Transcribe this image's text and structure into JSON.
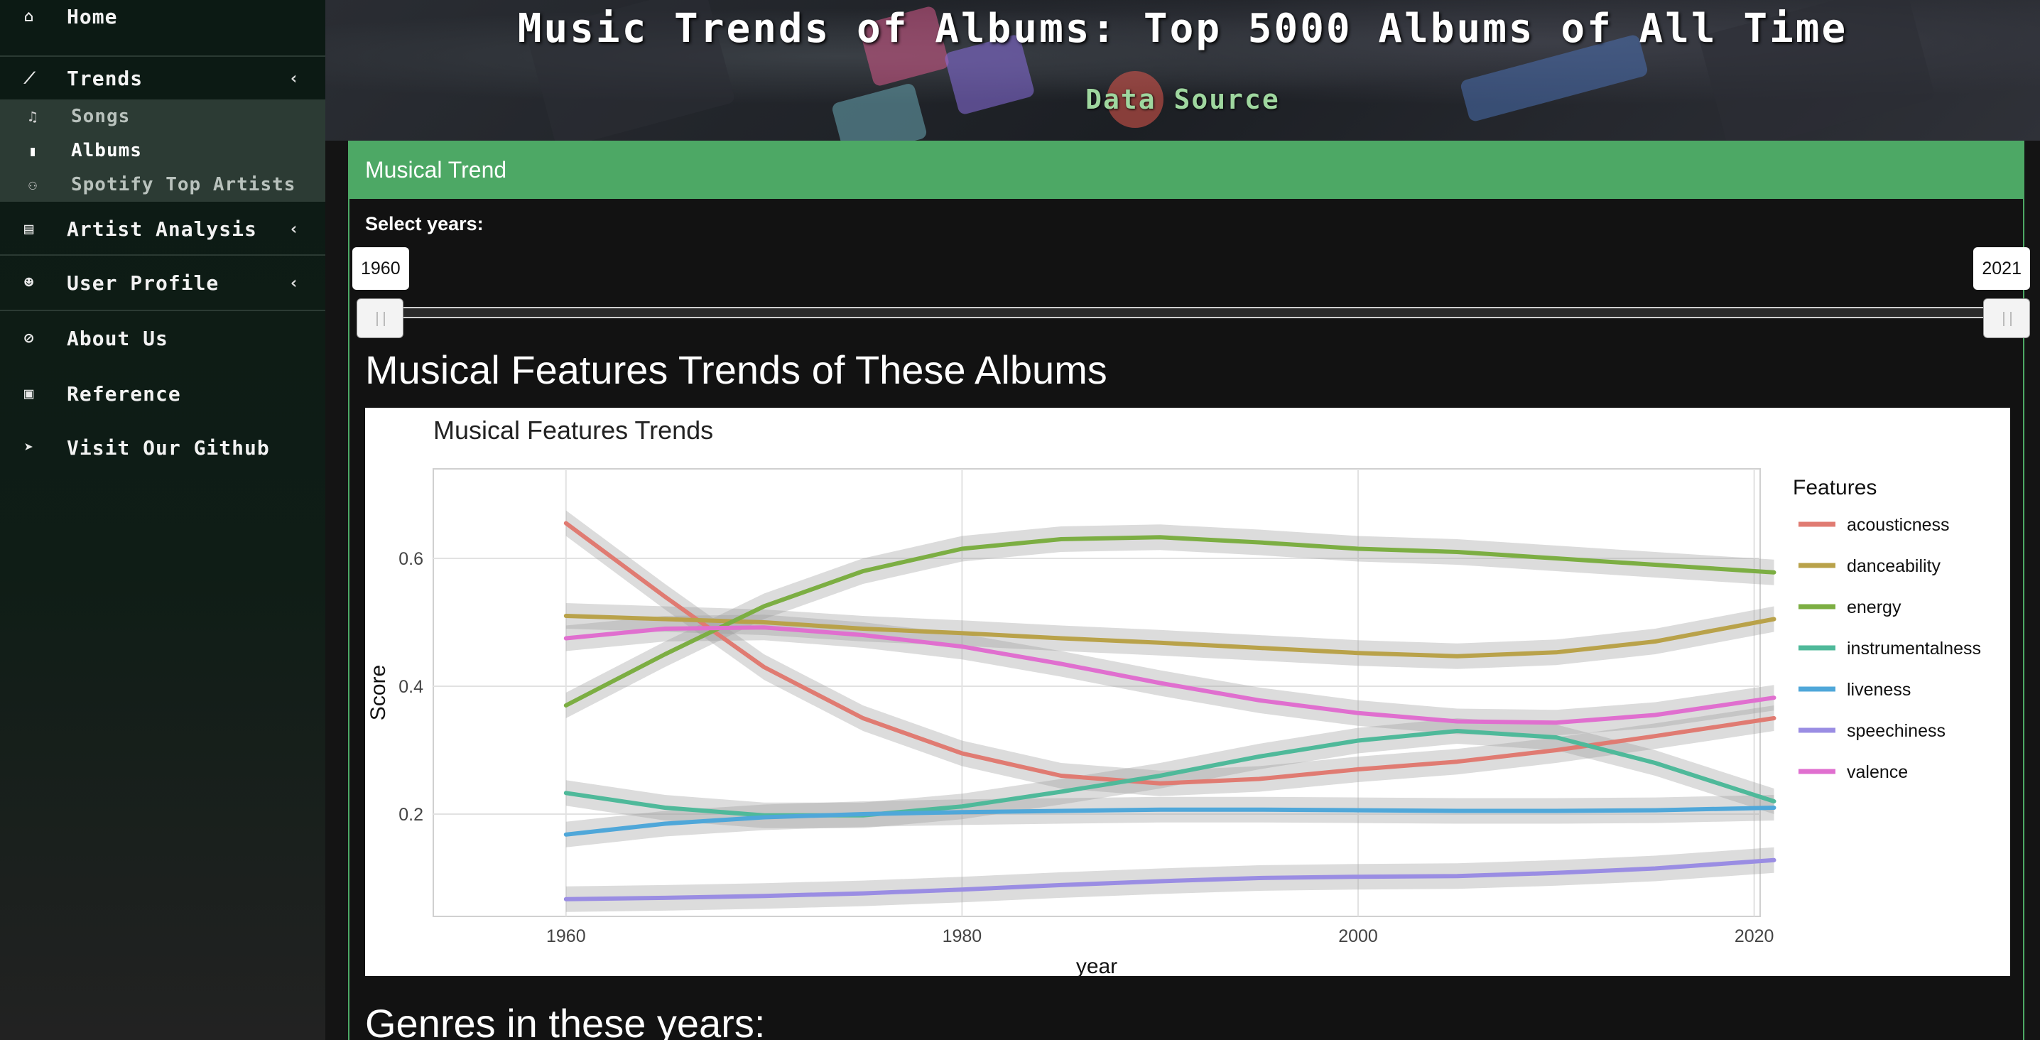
{
  "sidebar": {
    "items": [
      {
        "label": "Home",
        "icon": "home-icon"
      },
      {
        "label": "Trends",
        "icon": "chart-line-icon"
      },
      {
        "label": "Artist Analysis",
        "icon": "id-card-icon"
      },
      {
        "label": "User Profile",
        "icon": "user-circle-icon"
      },
      {
        "label": "About Us",
        "icon": "paperclip-icon"
      },
      {
        "label": "Reference",
        "icon": "book-icon"
      },
      {
        "label": "Visit Our Github",
        "icon": "send-icon"
      }
    ],
    "sub_items": [
      {
        "label": "Songs",
        "icon": "music-icon"
      },
      {
        "label": "Albums",
        "icon": "file-icon"
      },
      {
        "label": "Spotify Top Artists",
        "icon": "users-icon"
      }
    ],
    "chevron": "‹"
  },
  "header": {
    "title": "Music Trends of Albums: Top 5000 Albums of All Time",
    "data_source": "Data Source"
  },
  "box": {
    "title": "Musical Trend",
    "select_label": "Select years:",
    "slider_min": "1960",
    "slider_max": "2021",
    "section_title": "Musical Features Trends of These Albums",
    "genres_title": "Genres in these years:"
  },
  "colors": {
    "accent": "#4da865",
    "sidebar_bg": "#0f1d16"
  },
  "chart_data": {
    "type": "line",
    "title": "Musical Features Trends",
    "xlabel": "year",
    "ylabel": "Score",
    "legend_title": "Features",
    "legend_position": "right",
    "grid": true,
    "xlim": [
      1953.3,
      2020.3
    ],
    "ylim": [
      0.04,
      0.74
    ],
    "x_ticks": [
      1960,
      1980,
      2000,
      2020
    ],
    "y_ticks": [
      0.2,
      0.4,
      0.6
    ],
    "x": [
      1960,
      1965,
      1970,
      1975,
      1980,
      1985,
      1990,
      1995,
      2000,
      2005,
      2010,
      2015,
      2021
    ],
    "series": [
      {
        "name": "acousticness",
        "color": "#e07b72",
        "values": [
          0.655,
          0.54,
          0.43,
          0.35,
          0.295,
          0.26,
          0.248,
          0.255,
          0.27,
          0.282,
          0.3,
          0.322,
          0.35
        ]
      },
      {
        "name": "danceability",
        "color": "#b9a24a",
        "values": [
          0.51,
          0.505,
          0.5,
          0.49,
          0.483,
          0.475,
          0.468,
          0.46,
          0.452,
          0.447,
          0.453,
          0.47,
          0.505
        ]
      },
      {
        "name": "energy",
        "color": "#7cae43",
        "values": [
          0.37,
          0.45,
          0.525,
          0.58,
          0.615,
          0.63,
          0.633,
          0.625,
          0.615,
          0.61,
          0.6,
          0.59,
          0.578
        ]
      },
      {
        "name": "instrumentalness",
        "color": "#4fb99a",
        "values": [
          0.233,
          0.21,
          0.198,
          0.198,
          0.212,
          0.235,
          0.26,
          0.29,
          0.315,
          0.33,
          0.32,
          0.28,
          0.22
        ]
      },
      {
        "name": "liveness",
        "color": "#4fa7d9",
        "values": [
          0.168,
          0.185,
          0.195,
          0.2,
          0.203,
          0.205,
          0.207,
          0.207,
          0.206,
          0.205,
          0.205,
          0.206,
          0.21
        ]
      },
      {
        "name": "speechiness",
        "color": "#9a8de3",
        "values": [
          0.067,
          0.069,
          0.072,
          0.076,
          0.082,
          0.089,
          0.095,
          0.1,
          0.102,
          0.103,
          0.108,
          0.115,
          0.128
        ]
      },
      {
        "name": "valence",
        "color": "#e06fcf",
        "values": [
          0.475,
          0.49,
          0.492,
          0.48,
          0.462,
          0.435,
          0.405,
          0.378,
          0.358,
          0.345,
          0.343,
          0.355,
          0.382
        ]
      }
    ]
  }
}
